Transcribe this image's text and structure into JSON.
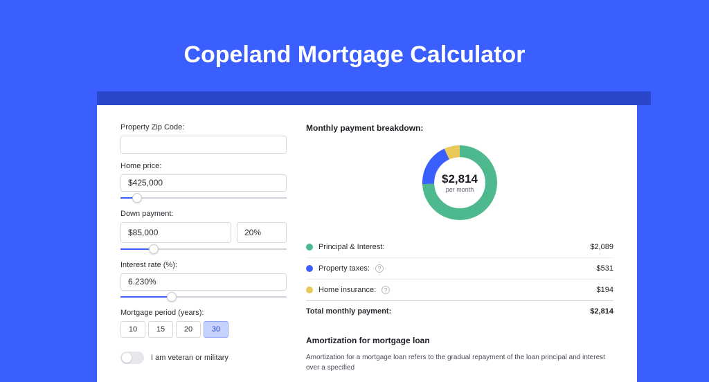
{
  "title": "Copeland Mortgage Calculator",
  "form": {
    "zip_label": "Property Zip Code:",
    "zip_value": "",
    "home_price_label": "Home price:",
    "home_price_value": "$425,000",
    "home_price_slider_pct": 10,
    "down_payment_label": "Down payment:",
    "down_payment_value": "$85,000",
    "down_payment_pct": "20%",
    "down_payment_slider_pct": 20,
    "interest_label": "Interest rate (%):",
    "interest_value": "6.230%",
    "interest_slider_pct": 31,
    "period_label": "Mortgage period (years):",
    "period_options": [
      "10",
      "15",
      "20",
      "30"
    ],
    "period_selected": "30",
    "veteran_label": "I am veteran or military"
  },
  "breakdown": {
    "title": "Monthly payment breakdown:",
    "center_amount": "$2,814",
    "center_sub": "per month",
    "rows": [
      {
        "color": "green",
        "label": "Principal & Interest:",
        "value": "$2,089",
        "info": false
      },
      {
        "color": "blue",
        "label": "Property taxes:",
        "value": "$531",
        "info": true
      },
      {
        "color": "yellow",
        "label": "Home insurance:",
        "value": "$194",
        "info": true
      }
    ],
    "total_label": "Total monthly payment:",
    "total_value": "$2,814"
  },
  "amortization": {
    "title": "Amortization for mortgage loan",
    "text": "Amortization for a mortgage loan refers to the gradual repayment of the loan principal and interest over a specified"
  },
  "chart_data": {
    "type": "pie",
    "title": "Monthly payment breakdown",
    "series": [
      {
        "name": "Principal & Interest",
        "value": 2089,
        "color": "#4eb98f"
      },
      {
        "name": "Property taxes",
        "value": 531,
        "color": "#3b5eff"
      },
      {
        "name": "Home insurance",
        "value": 194,
        "color": "#e8c95a"
      }
    ],
    "total": 2814
  }
}
